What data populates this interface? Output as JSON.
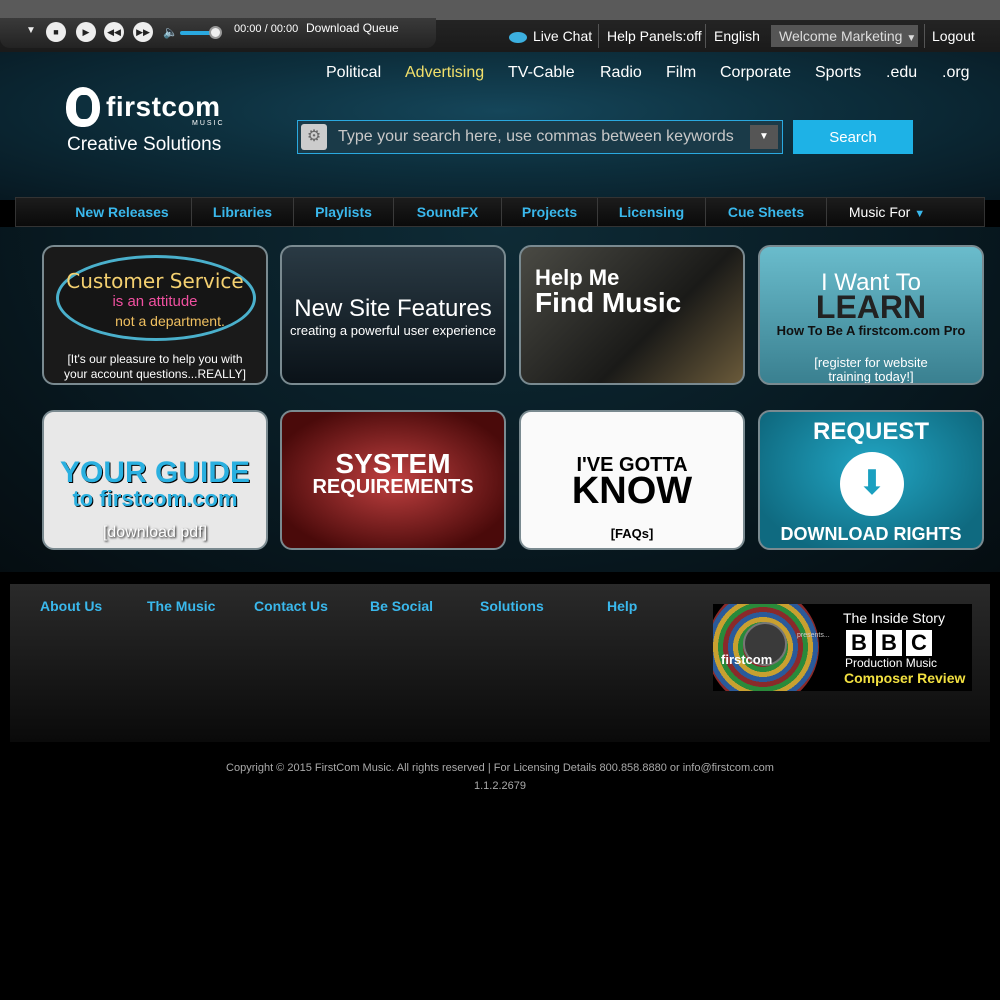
{
  "player": {
    "time": "00:00 / 00:00",
    "queue_label": "Download Queue"
  },
  "toplinks": {
    "live_chat": "Live Chat",
    "help_panels": "Help Panels:off",
    "language": "English",
    "welcome": "Welcome Marketing",
    "logout": "Logout"
  },
  "logo": {
    "name": "firstcom",
    "music": "MUSIC",
    "tagline": "Creative Solutions"
  },
  "categories": [
    "Political",
    "Advertising",
    "TV-Cable",
    "Radio",
    "Film",
    "Corporate",
    "Sports",
    ".edu",
    ".org"
  ],
  "search": {
    "placeholder": "Type your search here, use commas between keywords",
    "button_label": "Search"
  },
  "nav": {
    "items": [
      "New Releases",
      "Libraries",
      "Playlists",
      "SoundFX",
      "Projects",
      "Licensing",
      "Cue Sheets"
    ],
    "music_for": "Music For"
  },
  "tiles": {
    "customer_service": {
      "line1": "Customer Service",
      "line2": "is an attitude",
      "line3": "not a department.",
      "caption1": "[It's our pleasure to help you with",
      "caption2": "your account questions...REALLY]"
    },
    "new_features": {
      "title": "New Site Features",
      "subtitle": "creating a powerful user experience"
    },
    "find_music": {
      "line1": "Help Me",
      "line2": "Find Music"
    },
    "learn": {
      "line1": "I Want To",
      "line2": "LEARN",
      "line3": "How To Be A firstcom.com Pro",
      "caption1": "[register for website",
      "caption2": "training today!]"
    },
    "guide": {
      "line1": "YOUR GUIDE",
      "line2": "to firstcom.com",
      "caption": "[download pdf]"
    },
    "system": {
      "line1": "SYSTEM",
      "line2": "REQUIREMENTS"
    },
    "faq": {
      "line1": "I'VE GOTTA",
      "line2": "KNOW",
      "caption": "[FAQs]"
    },
    "download_rights": {
      "line1": "REQUEST",
      "line2": "DOWNLOAD RIGHTS"
    }
  },
  "footer": {
    "links": [
      "About Us",
      "The Music",
      "Contact Us",
      "Be Social",
      "Solutions",
      "Help"
    ],
    "promo": {
      "firstcom": "firstcom",
      "presents": "presents...",
      "inside_story": "The Inside Story",
      "bbc": [
        "B",
        "B",
        "C"
      ],
      "production_music": "Production Music",
      "composer_review": "Composer Review"
    },
    "copyright": "Copyright © 2015 FirstCom Music. All rights reserved | For Licensing Details 800.858.8880 or info@firstcom.com",
    "version": "1.1.2.2679"
  },
  "colors": {
    "accent": "#3ab8ec",
    "active_category": "#f2e06a",
    "search_button": "#1eb2e6"
  }
}
